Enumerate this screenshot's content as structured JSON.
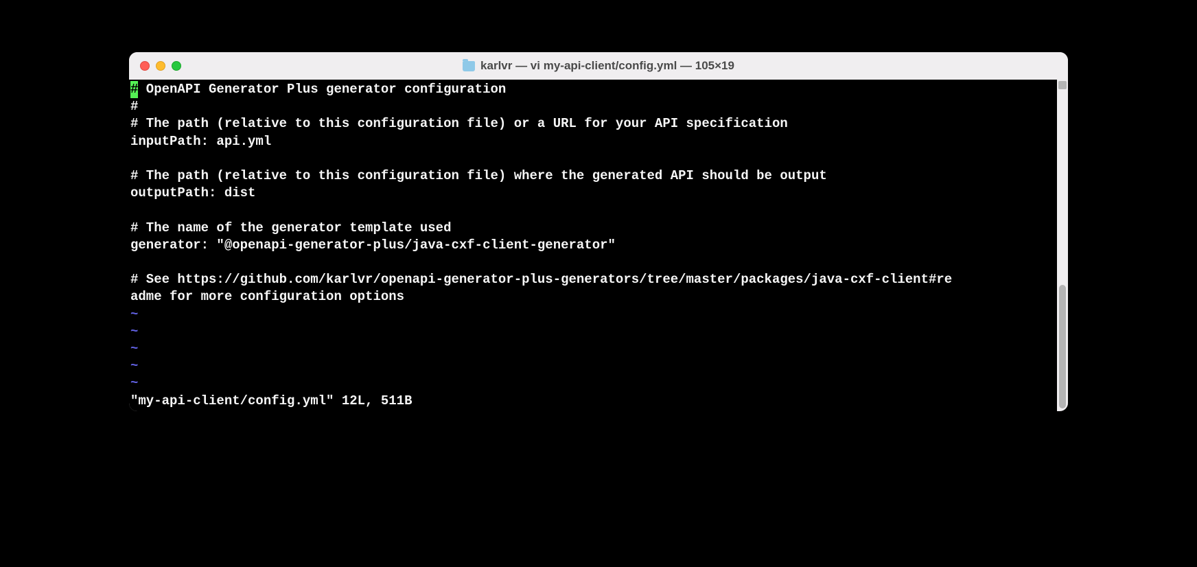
{
  "window": {
    "title": "karlvr — vi my-api-client/config.yml — 105×19"
  },
  "editor": {
    "cursor_char": "#",
    "lines": [
      {
        "type": "first",
        "rest": " OpenAPI Generator Plus generator configuration"
      },
      {
        "type": "text",
        "content": "#"
      },
      {
        "type": "text",
        "content": "# The path (relative to this configuration file) or a URL for your API specification"
      },
      {
        "type": "text",
        "content": "inputPath: api.yml"
      },
      {
        "type": "text",
        "content": ""
      },
      {
        "type": "text",
        "content": "# The path (relative to this configuration file) where the generated API should be output"
      },
      {
        "type": "text",
        "content": "outputPath: dist"
      },
      {
        "type": "text",
        "content": ""
      },
      {
        "type": "text",
        "content": "# The name of the generator template used"
      },
      {
        "type": "text",
        "content": "generator: \"@openapi-generator-plus/java-cxf-client-generator\""
      },
      {
        "type": "text",
        "content": ""
      },
      {
        "type": "text",
        "content": "# See https://github.com/karlvr/openapi-generator-plus-generators/tree/master/packages/java-cxf-client#re"
      },
      {
        "type": "text",
        "content": "adme for more configuration options"
      },
      {
        "type": "tilde",
        "content": "~"
      },
      {
        "type": "tilde",
        "content": "~"
      },
      {
        "type": "tilde",
        "content": "~"
      },
      {
        "type": "tilde",
        "content": "~"
      },
      {
        "type": "tilde",
        "content": "~"
      },
      {
        "type": "text",
        "content": "\"my-api-client/config.yml\" 12L, 511B"
      }
    ]
  }
}
